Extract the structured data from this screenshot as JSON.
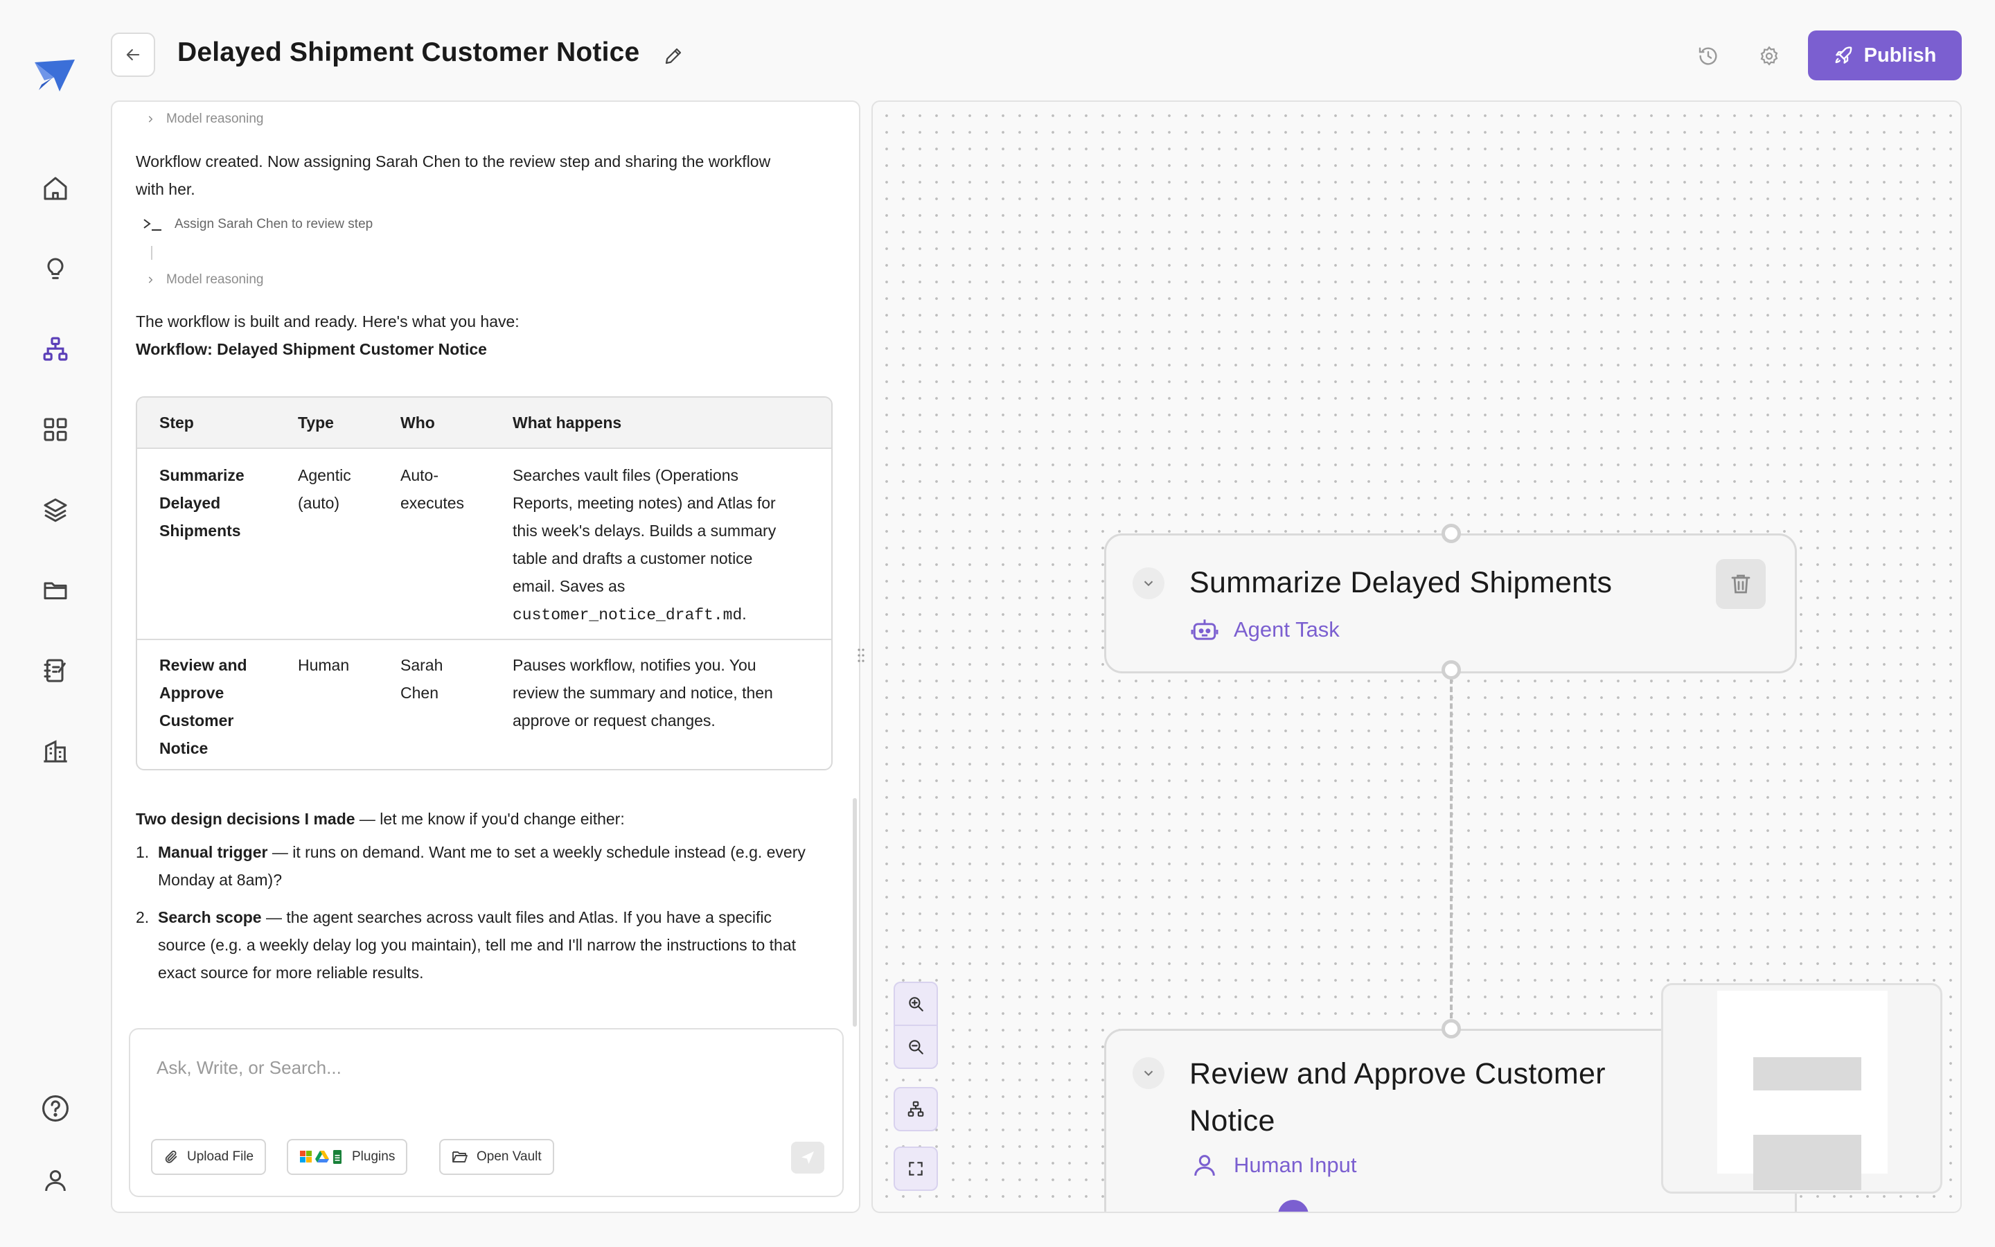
{
  "header": {
    "title": "Delayed Shipment Customer Notice",
    "publish_label": "Publish"
  },
  "sidebar": {
    "items": [
      {
        "icon": "home-icon",
        "active": false
      },
      {
        "icon": "lightbulb-icon",
        "active": false
      },
      {
        "icon": "workflow-icon",
        "active": true
      },
      {
        "icon": "grid-icon",
        "active": false
      },
      {
        "icon": "layers-icon",
        "active": false
      },
      {
        "icon": "folder-icon",
        "active": false
      },
      {
        "icon": "notebook-icon",
        "active": false
      },
      {
        "icon": "building-icon",
        "active": false
      }
    ],
    "bottom": [
      "help-icon",
      "user-icon"
    ]
  },
  "chat": {
    "reasoning_label_1": "Model reasoning",
    "message_1": "Workflow created. Now assigning Sarah Chen to the review step and sharing the workflow with her.",
    "message_1_line1": "Workflow created. Now assigning Sarah Chen to the review step and sharing the workflow",
    "message_1_line2": "with her.",
    "tool_call": "Assign Sarah Chen to review step",
    "reasoning_label_2": "Model reasoning",
    "intro": "The workflow is built and ready. Here's what you have:",
    "workflow_heading": "Workflow: Delayed Shipment Customer Notice",
    "table": {
      "headers": [
        "Step",
        "Type",
        "Who",
        "What happens"
      ],
      "rows": [
        {
          "step": [
            "Summarize",
            "Delayed",
            "Shipments"
          ],
          "type": [
            "Agentic",
            "(auto)"
          ],
          "who": [
            "Auto-",
            "executes"
          ],
          "what": [
            "Searches vault files (Operations",
            "Reports, meeting notes) and Atlas for",
            "this week's delays. Builds a summary",
            "table and drafts a customer notice",
            "email. Saves as"
          ],
          "what_code": "customer_notice_draft.md",
          "what_end": "."
        },
        {
          "step": [
            "Review and",
            "Approve",
            "Customer",
            "Notice"
          ],
          "type": [
            "Human"
          ],
          "who": [
            "Sarah",
            "Chen"
          ],
          "what": [
            "Pauses workflow, notifies you. You",
            "review the summary and notice, then",
            "approve or request changes."
          ]
        }
      ]
    },
    "decisions_bold": "Two design decisions I made",
    "decisions_rest": " — let me know if you'd change either:",
    "decisions": [
      {
        "num": "1.",
        "bold": "Manual trigger",
        "line1": " — it runs on demand. Want me to set a weekly schedule instead (e.g. every",
        "line2": "Monday at 8am)?"
      },
      {
        "num": "2.",
        "bold": "Search scope",
        "line1": " — the agent searches across vault files and Atlas. If you have a specific",
        "line2": "source (e.g. a weekly delay log you maintain), tell me and I'll narrow the instructions to that",
        "line3": "exact source for more reliable results."
      }
    ],
    "composer_placeholder": "Ask, Write, or Search...",
    "upload_label": "Upload File",
    "plugins_label": "Plugins",
    "vault_label": "Open Vault"
  },
  "canvas": {
    "nodes": [
      {
        "title": "Summarize Delayed Shipments",
        "type": "Agent Task",
        "icon": "robot-icon"
      },
      {
        "title_line1": "Review and Approve Customer",
        "title_line2": "Notice",
        "type": "Human Input",
        "icon": "person-icon"
      }
    ],
    "controls": [
      "zoom-in-icon",
      "zoom-out-icon",
      "auto-layout-icon",
      "fit-view-icon"
    ]
  },
  "colors": {
    "accent": "#7b5fd0",
    "logo": "#3b6fd8"
  }
}
